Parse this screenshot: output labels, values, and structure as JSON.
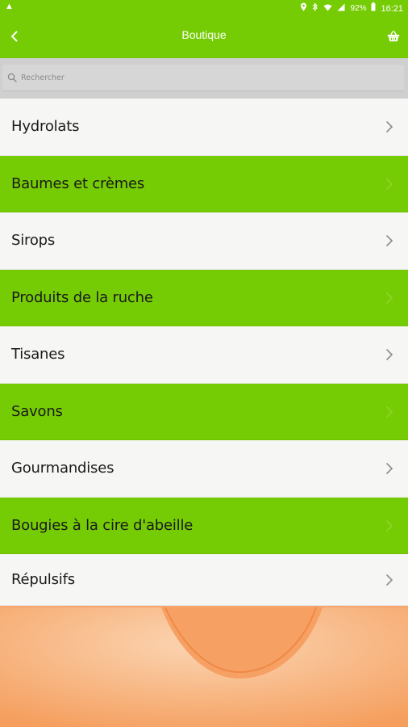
{
  "status_bar": {
    "left_icon": "warning-triangle-icon",
    "battery_percent": "92%",
    "time": "16:21",
    "icons": [
      "location-icon",
      "bluetooth-icon",
      "wifi-icon",
      "signal-icon",
      "battery-icon"
    ]
  },
  "header": {
    "title": "Boutique",
    "back_icon": "chevron-left-icon",
    "cart_icon": "basket-icon"
  },
  "search": {
    "placeholder": "Rechercher",
    "icon": "search-icon"
  },
  "categories": [
    {
      "label": "Hydrolats"
    },
    {
      "label": "Baumes et crèmes"
    },
    {
      "label": "Sirops"
    },
    {
      "label": "Produits de la ruche"
    },
    {
      "label": "Tisanes"
    },
    {
      "label": "Savons"
    },
    {
      "label": "Gourmandises"
    },
    {
      "label": "Bougies à la cire d'abeille"
    },
    {
      "label": "Répulsifs"
    }
  ],
  "colors": {
    "accent_green": "#76cc04",
    "row_light": "#f6f6f4",
    "background_peach": "#f7a56d"
  }
}
